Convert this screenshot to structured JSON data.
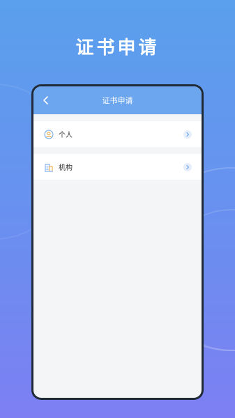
{
  "hero": {
    "title": "证书申请"
  },
  "navbar": {
    "title": "证书申请",
    "back_icon": "chevron-left-icon"
  },
  "list": {
    "items": [
      {
        "label": "个人",
        "icon": "person-icon"
      },
      {
        "label": "机构",
        "icon": "building-icon"
      }
    ]
  },
  "colors": {
    "navbar": "#6ba6ee",
    "background_top": "#5aa0ec",
    "background_bottom": "#7d7ff2",
    "phone_frame": "#1f2a36",
    "icon_accent": "#6ba6ee"
  }
}
